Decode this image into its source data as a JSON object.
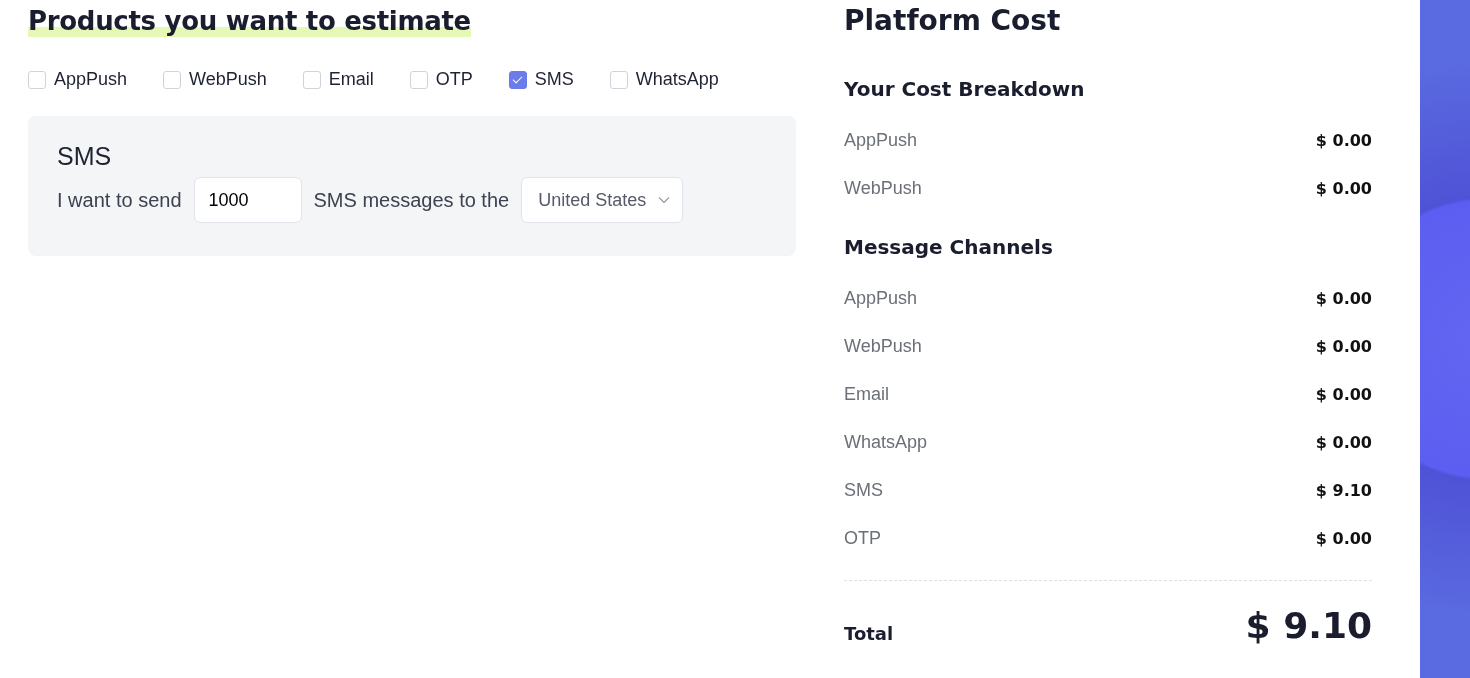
{
  "heading": "Products you want to estimate",
  "products": [
    {
      "label": "AppPush",
      "checked": false
    },
    {
      "label": "WebPush",
      "checked": false
    },
    {
      "label": "Email",
      "checked": false
    },
    {
      "label": "OTP",
      "checked": false
    },
    {
      "label": "SMS",
      "checked": true
    },
    {
      "label": "WhatsApp",
      "checked": false
    }
  ],
  "detail_card": {
    "title": "SMS",
    "text_before": "I want to send",
    "quantity": "1000",
    "text_middle": "SMS messages to the",
    "country": "United States"
  },
  "cost_panel": {
    "title": "Platform Cost",
    "sections": [
      {
        "title": "Your Cost Breakdown",
        "items": [
          {
            "label": "AppPush",
            "amount": "$ 0.00"
          },
          {
            "label": "WebPush",
            "amount": "$ 0.00"
          }
        ]
      },
      {
        "title": "Message Channels",
        "items": [
          {
            "label": "AppPush",
            "amount": "$ 0.00"
          },
          {
            "label": "WebPush",
            "amount": "$ 0.00"
          },
          {
            "label": "Email",
            "amount": "$ 0.00"
          },
          {
            "label": "WhatsApp",
            "amount": "$ 0.00"
          },
          {
            "label": "SMS",
            "amount": "$ 9.10"
          },
          {
            "label": "OTP",
            "amount": "$ 0.00"
          }
        ]
      }
    ],
    "total_label": "Total",
    "total_amount": "$ 9.10"
  }
}
